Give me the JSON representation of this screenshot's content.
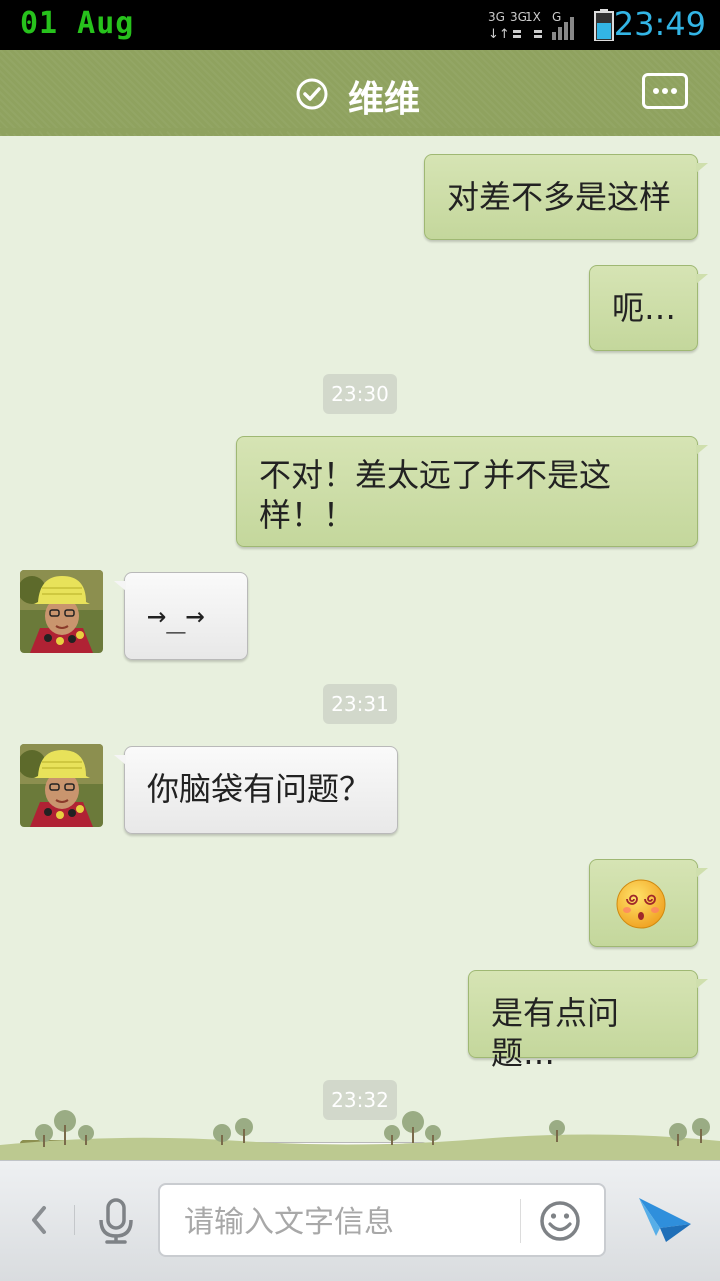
{
  "status_bar": {
    "date": "01 Aug",
    "time": "23:49"
  },
  "header": {
    "contact_name": "维维",
    "verified_icon": "check-circle-icon",
    "menu_icon": "more-dots-icon"
  },
  "messages": [
    {
      "type": "out",
      "text": "对差不多是这样"
    },
    {
      "type": "out",
      "text": "呃…"
    },
    {
      "type": "time",
      "text": "23:30"
    },
    {
      "type": "out",
      "text": "不对！差太远了并不是这样！！"
    },
    {
      "type": "in",
      "text": "→_→"
    },
    {
      "type": "time",
      "text": "23:31"
    },
    {
      "type": "in",
      "text": "你脑袋有问题？"
    },
    {
      "type": "out",
      "emoji": "dizzy-face-emoji"
    },
    {
      "type": "out",
      "text": "是有点问题…"
    },
    {
      "type": "time",
      "text": "23:32"
    },
    {
      "type": "in",
      "text": ""
    }
  ],
  "input_bar": {
    "placeholder": "请输入文字信息",
    "back_icon": "chevron-left-icon",
    "mic_icon": "microphone-icon",
    "emoji_icon": "smiley-icon",
    "send_icon": "send-icon"
  },
  "colors": {
    "header": "#8fa25f",
    "chat_background": "#e8f0de",
    "outgoing_bubble": "#cfdfad",
    "incoming_bubble": "#f2f2f2",
    "time_color": "#33b5e5",
    "date_color": "#27c21c"
  }
}
